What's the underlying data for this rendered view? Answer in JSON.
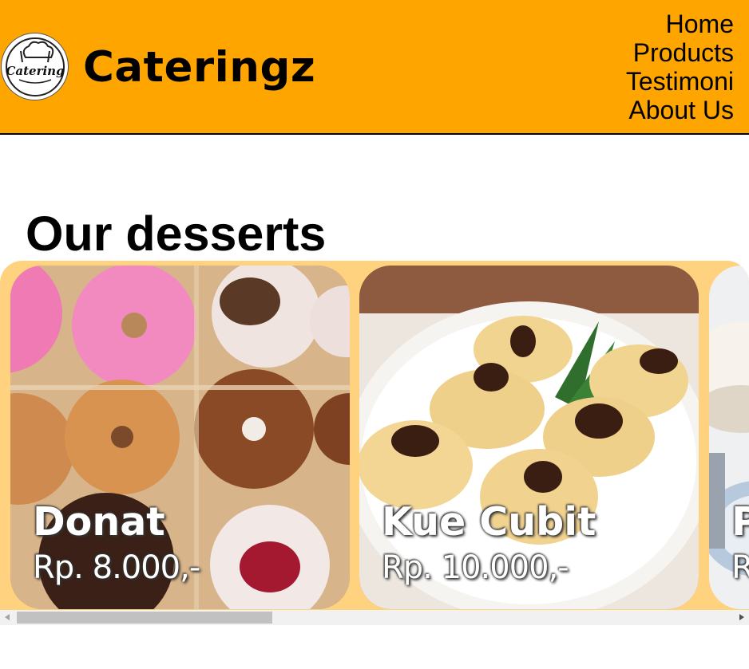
{
  "header": {
    "brand": "Cateringz",
    "logo_text": "Catering",
    "nav": [
      "Home",
      "Products",
      "Testimoni",
      "About Us"
    ]
  },
  "main": {
    "section_title": "Our desserts",
    "products": [
      {
        "name": "Donat",
        "price": "Rp. 8.000,-"
      },
      {
        "name": "Kue Cubit",
        "price": "Rp. 10.000,-"
      },
      {
        "name": "P",
        "price": "R"
      }
    ]
  },
  "colors": {
    "header_bg": "#ffa500",
    "carousel_bg": "#ffd27f"
  },
  "icons": [
    "chef-hat-icon",
    "scroll-left-arrow-icon",
    "scroll-right-arrow-icon"
  ]
}
